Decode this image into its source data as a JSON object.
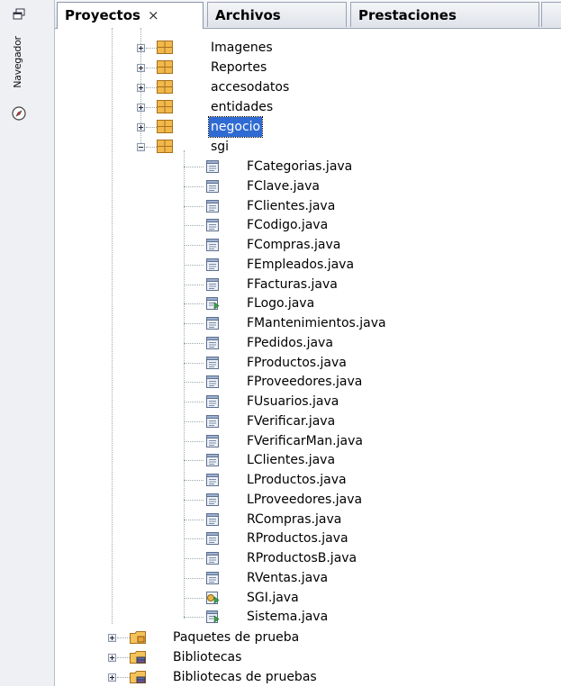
{
  "side": {
    "navigator_label": "Navegador"
  },
  "tabs": [
    {
      "label": "Proyectos",
      "close": "×",
      "active": true
    },
    {
      "label": "Archivos",
      "active": false
    },
    {
      "label": "Prestaciones",
      "active": false
    }
  ],
  "tree": {
    "packages": [
      "Imagenes",
      "Reportes",
      "accesodatos",
      "entidades",
      "negocio",
      "sgi"
    ],
    "selected": "negocio",
    "files": [
      "FCategorias.java",
      "FClave.java",
      "FClientes.java",
      "FCodigo.java",
      "FCompras.java",
      "FEmpleados.java",
      "FFacturas.java",
      "FLogo.java",
      "FMantenimientos.java",
      "FPedidos.java",
      "FProductos.java",
      "FProveedores.java",
      "FUsuarios.java",
      "FVerificar.java",
      "FVerificarMan.java",
      "LClientes.java",
      "LProductos.java",
      "LProveedores.java",
      "RCompras.java",
      "RProductos.java",
      "RProductosB.java",
      "RVentas.java",
      "SGI.java",
      "Sistema.java"
    ],
    "roots": [
      "Paquetes de prueba",
      "Bibliotecas",
      "Bibliotecas de pruebas"
    ]
  },
  "colors": {
    "selection": "#2f6bd3",
    "package": "#e8a33a"
  }
}
